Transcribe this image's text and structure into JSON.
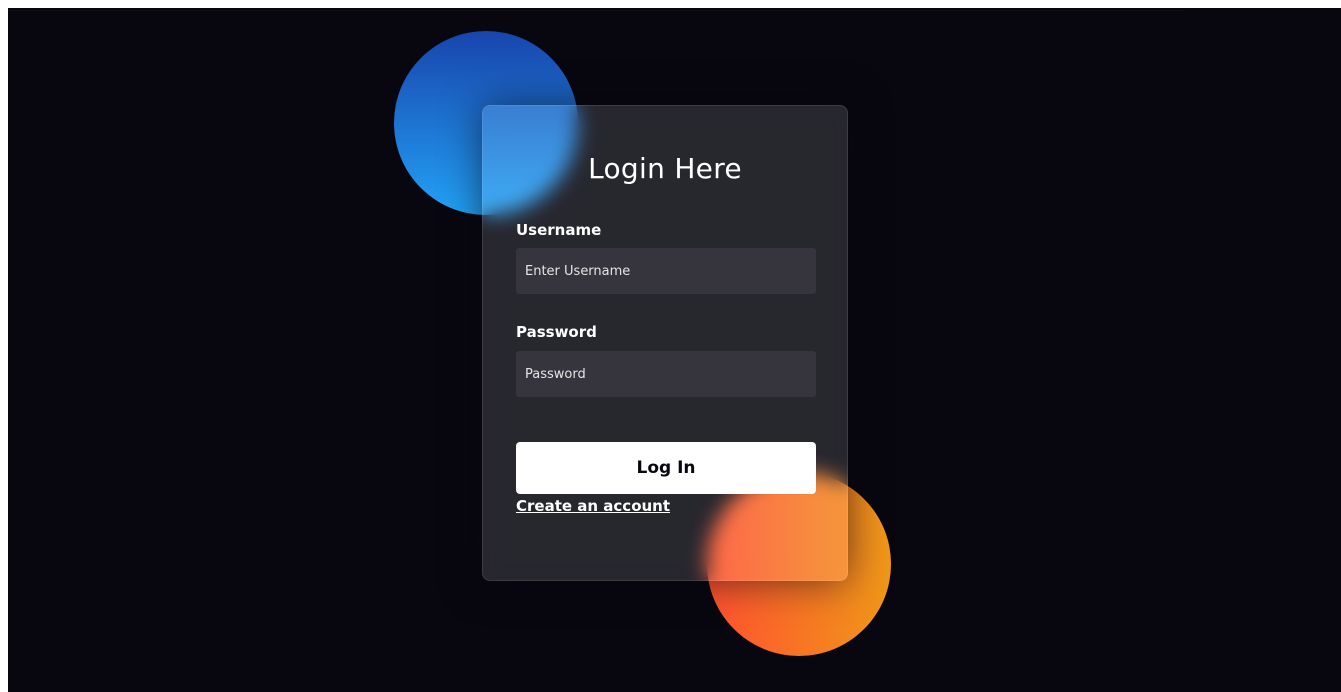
{
  "form": {
    "title": "Login Here",
    "username_label": "Username",
    "username_placeholder": "Enter Username",
    "username_value": "",
    "password_label": "Password",
    "password_placeholder": "Password",
    "password_value": "",
    "login_button_label": "Log In",
    "create_account_link": "Create an account"
  },
  "colors": {
    "background": "#080710",
    "card": "rgba(255,255,255,0.13)",
    "blue_gradient": [
      "#1845ad",
      "#23a2f6"
    ],
    "orange_gradient": [
      "#ff512f",
      "#f09819"
    ],
    "button": "#ffffff",
    "button_text": "#080710",
    "text": "#ffffff"
  }
}
